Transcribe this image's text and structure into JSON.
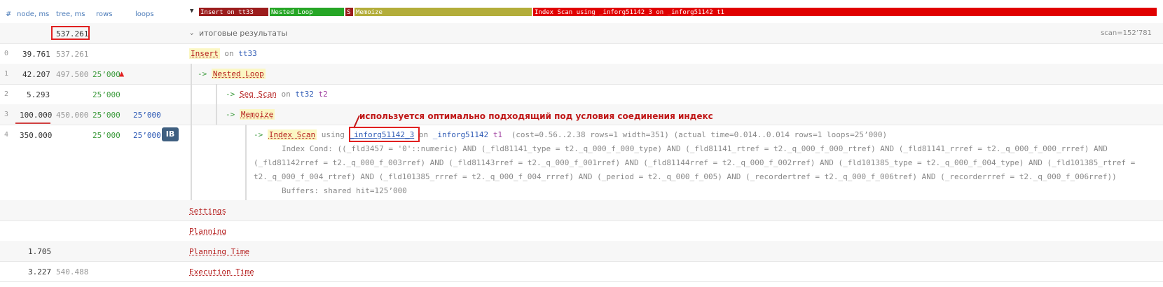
{
  "header": {
    "col_idx": "#",
    "col_node": "node, ms",
    "col_tree": "tree, ms",
    "col_rows": "rows",
    "col_loops": "loops",
    "flame": [
      {
        "label": "Insert on tt33",
        "color": "#9b1c1c"
      },
      {
        "label": "Nested Loop",
        "color": "#26a626"
      },
      {
        "label": "S",
        "color": "#9b1c1c"
      },
      {
        "label": "Memoize",
        "color": "#b3ad3a"
      },
      {
        "label": "Index Scan using _inforg51142_3 on _inforg51142 t1",
        "color": "#e00000"
      }
    ]
  },
  "summary": {
    "total_ms": "537.261",
    "label": "итоговые результаты",
    "scan": "scan=152’781"
  },
  "nodes": [
    {
      "idx": "0",
      "node_ms": "39.761",
      "tree_ms": "537.261",
      "rows": "",
      "loops": "",
      "kw": "Insert",
      "rest_on": "on",
      "rest_tbl": "tt33"
    },
    {
      "idx": "1",
      "node_ms": "42.207",
      "tree_ms": "497.500",
      "rows": "25’000",
      "loops": "",
      "kw": "Nested Loop"
    },
    {
      "idx": "2",
      "node_ms": "5.293",
      "tree_ms": "",
      "rows": "25’000",
      "loops": "",
      "kw": "Seq Scan",
      "rest_on": "on",
      "rest_tbl": "tt32",
      "alias": "t2"
    },
    {
      "idx": "3",
      "node_ms": "100.000",
      "tree_ms": "450.000",
      "rows": "25’000",
      "loops": "25’000",
      "kw": "Memoize"
    },
    {
      "idx": "4",
      "node_ms": "350.000",
      "tree_ms": "",
      "rows": "25’000",
      "loops": "25’000",
      "badge": "IB",
      "kw": "Index Scan",
      "using": "using",
      "index": "_inforg51142_3",
      "on": "on",
      "tbl": "_inforg51142",
      "alias": "t1",
      "cost_text": "(cost=0.56..2.38 rows=1 width=351) (actual time=0.014..0.014 rows=1 loops=25’000)",
      "cond_1": "Index Cond: ((_fld3457 = '0'::numeric) AND (_fld81141_type = t2._q_000_f_000_type) AND (_fld81141_rtref = t2._q_000_f_000_rtref) AND (_fld81141_rrref = t2._q_000_f_000_rrref) AND",
      "cond_2": "(_fld81142rref = t2._q_000_f_003rref) AND (_fld81143rref = t2._q_000_f_001rref) AND (_fld81144rref = t2._q_000_f_002rref) AND (_fld101385_type = t2._q_000_f_004_type) AND (_fld101385_rtref =",
      "cond_3": "t2._q_000_f_004_rtref) AND (_fld101385_rrref = t2._q_000_f_004_rrref) AND (_period = t2._q_000_f_005) AND (_recordertref = t2._q_000_f_006tref) AND (_recorderrref = t2._q_000_f_006rref))",
      "buffers": "Buffers: shared hit=125’000"
    }
  ],
  "annotation": "используется оптимально подходящий под условия соединения индекс",
  "footer": [
    {
      "label": "Settings",
      "node_ms": "",
      "tree_ms": ""
    },
    {
      "label": "Planning",
      "node_ms": "",
      "tree_ms": ""
    },
    {
      "label": "Planning Time",
      "node_ms": "1.705",
      "tree_ms": ""
    },
    {
      "label": "Execution Time",
      "node_ms": "3.227",
      "tree_ms": "540.488"
    }
  ]
}
